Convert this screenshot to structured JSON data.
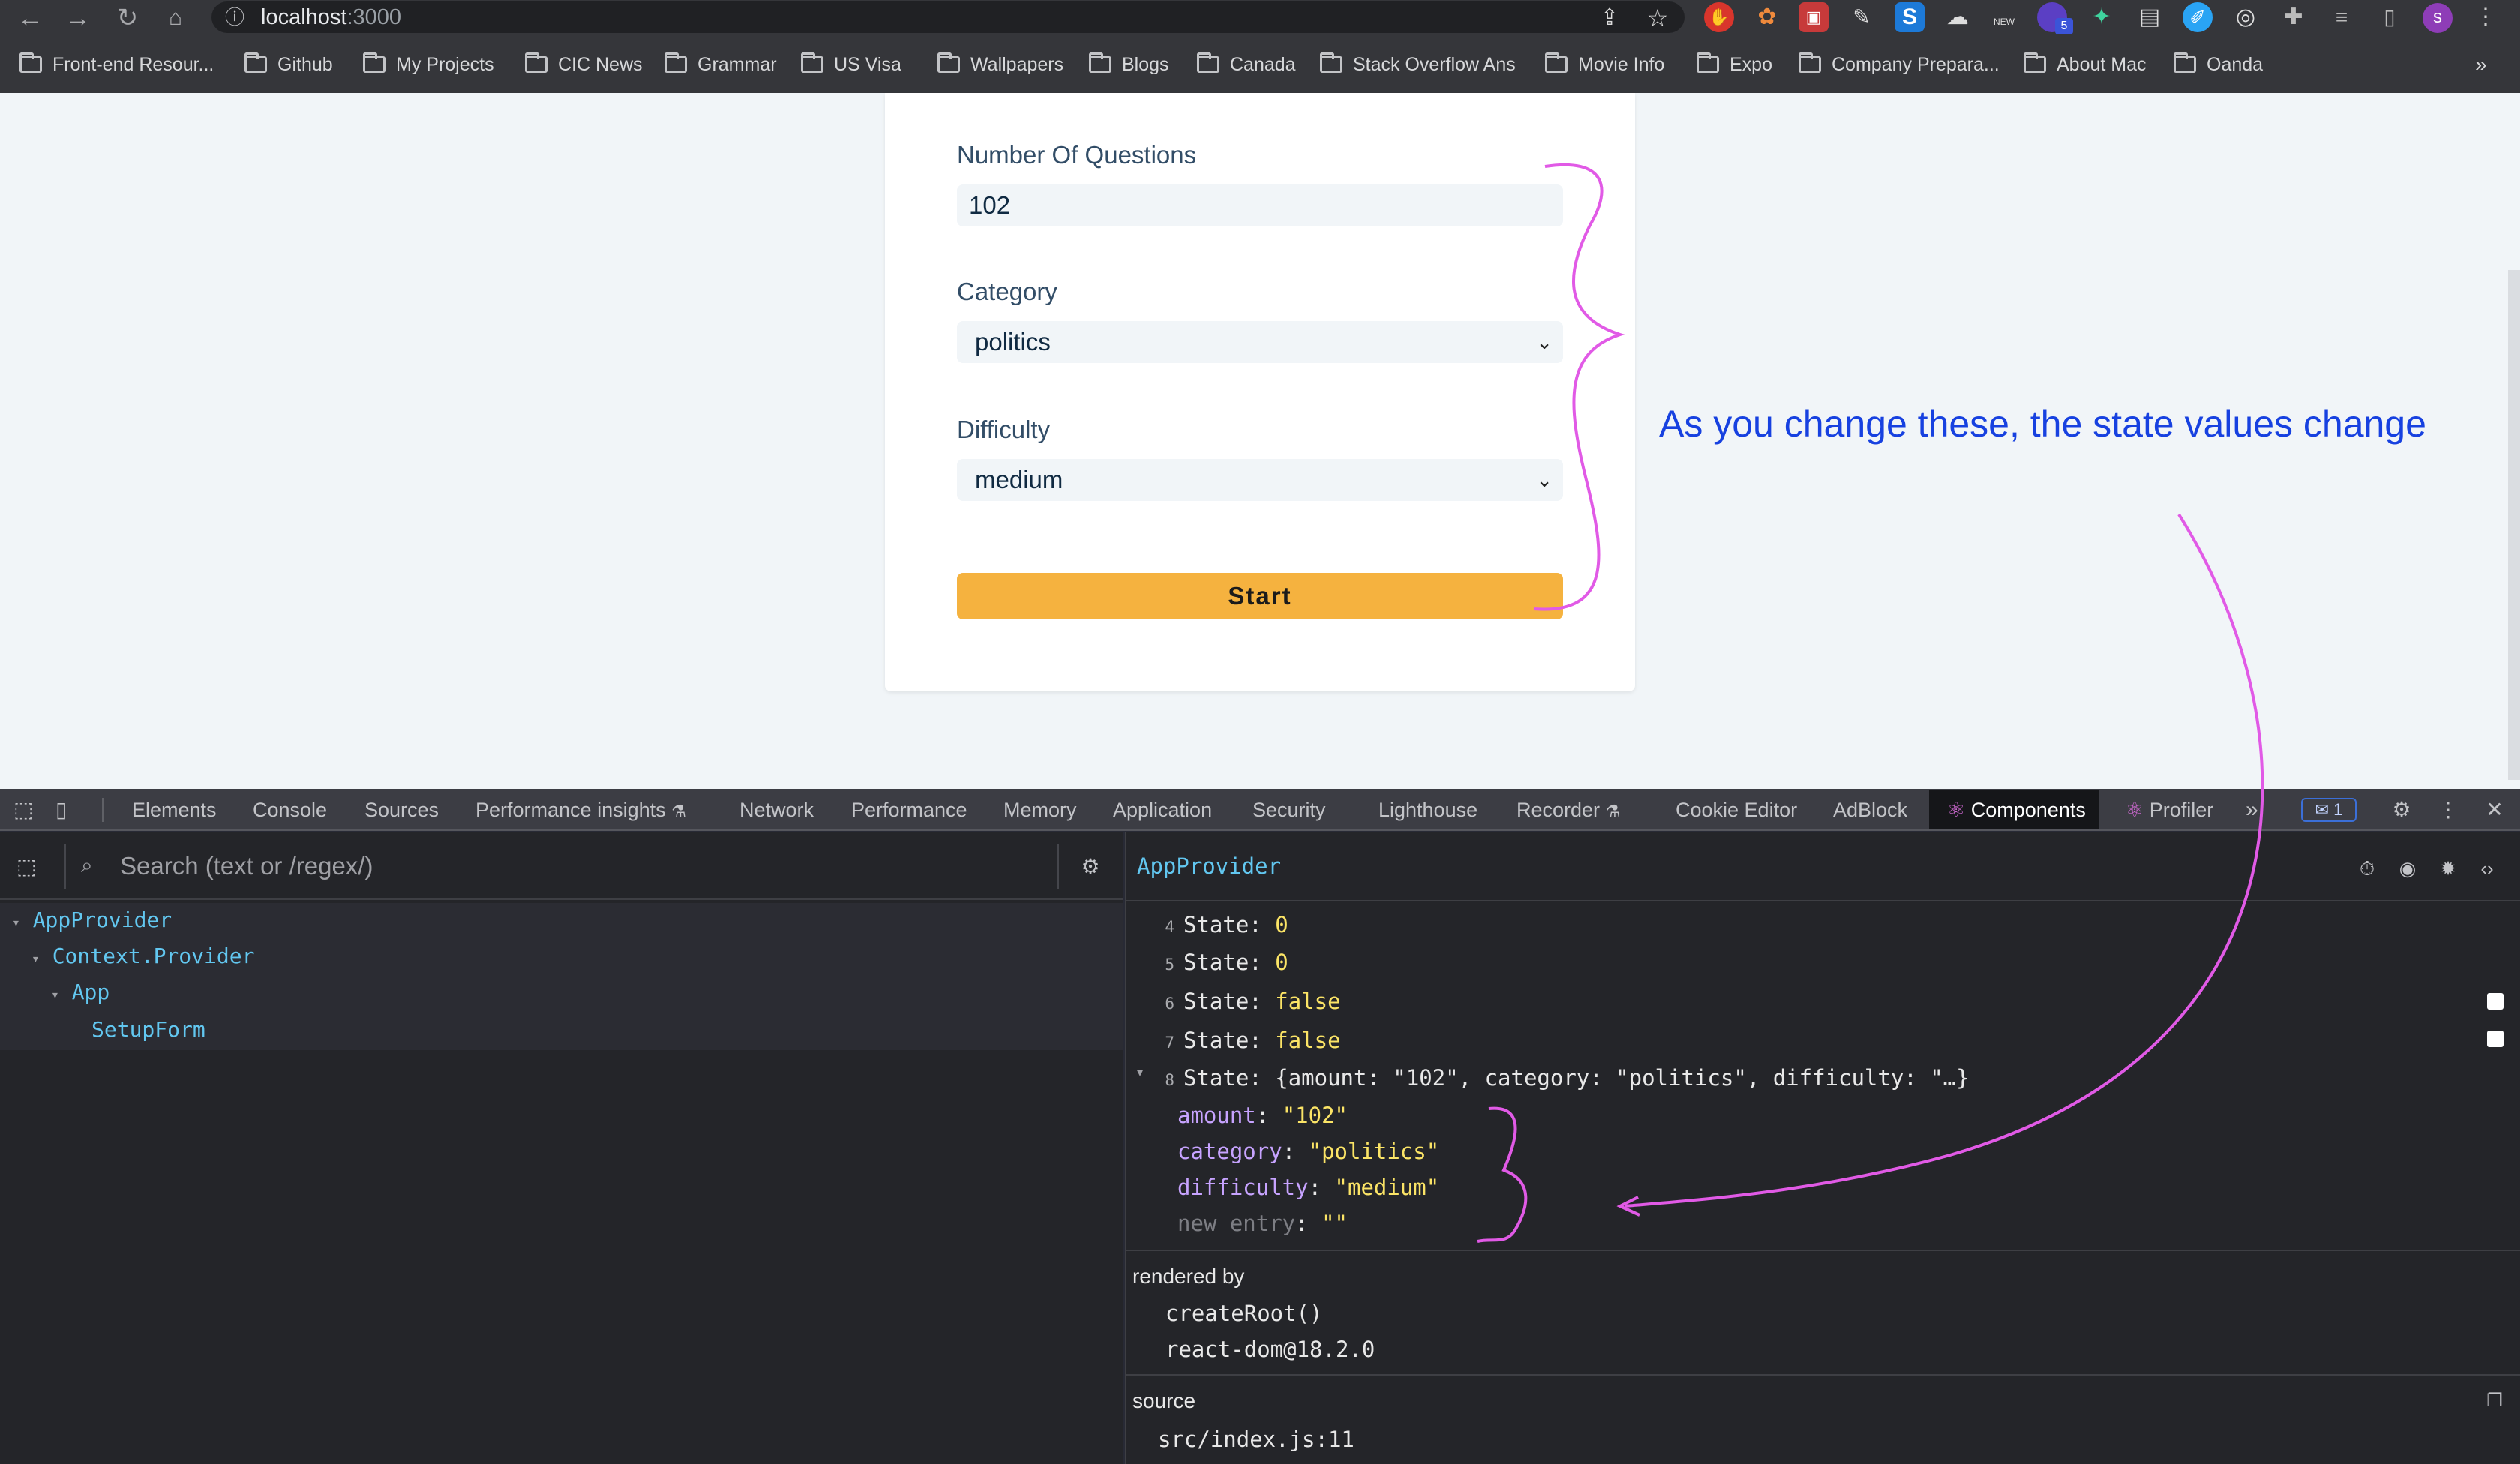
{
  "browser": {
    "url_host": "localhost",
    "url_port": ":3000",
    "bookmarks": [
      "Front-end Resour...",
      "Github",
      "My Projects",
      "CIC News",
      "Grammar",
      "US Visa",
      "Wallpapers",
      "Blogs",
      "Canada",
      "Stack Overflow Ans",
      "Movie Info",
      "Expo",
      "Company Prepara...",
      "About Mac",
      "Oanda"
    ],
    "more": "»",
    "ext_badge": "5",
    "ext_new": "NEW",
    "profile": "s"
  },
  "form": {
    "amount_label": "Number Of Questions",
    "amount_value": "102",
    "category_label": "Category",
    "category_value": "politics",
    "difficulty_label": "Difficulty",
    "difficulty_value": "medium",
    "start_label": "Start"
  },
  "annotation": {
    "text": "As you change these, the state values change",
    "color": "#1741e0",
    "brace_color": "#e15ae6"
  },
  "devtools": {
    "tabs": [
      "Elements",
      "Console",
      "Sources",
      "Performance insights",
      "Network",
      "Performance",
      "Memory",
      "Application",
      "Security",
      "Lighthouse",
      "Recorder",
      "Cookie Editor",
      "AdBlock",
      "Components",
      "Profiler"
    ],
    "more_tabs": "»",
    "issues_count": "1",
    "search_placeholder": "Search (text or /regex/)",
    "tree": [
      "AppProvider",
      "Context.Provider",
      "App",
      "SetupForm"
    ],
    "selected_component": "AppProvider",
    "state_rows": [
      {
        "index": "4",
        "label": "State:",
        "value": "0"
      },
      {
        "index": "5",
        "label": "State:",
        "value": "0"
      },
      {
        "index": "6",
        "label": "State:",
        "value": "false"
      },
      {
        "index": "7",
        "label": "State:",
        "value": "false"
      },
      {
        "index": "8",
        "label": "State:",
        "value": "{amount: \"102\", category: \"politics\", difficulty: \"…}"
      }
    ],
    "state_object": [
      {
        "key": "amount",
        "value": "\"102\""
      },
      {
        "key": "category",
        "value": "\"politics\""
      },
      {
        "key": "difficulty",
        "value": "\"medium\""
      },
      {
        "key": "new entry",
        "value": "\"\""
      }
    ],
    "rendered_by_title": "rendered by",
    "rendered_by": [
      "createRoot()",
      "react-dom@18.2.0"
    ],
    "source_title": "source",
    "source": "src/index.js:11",
    "accent_color": "#62c7f0",
    "value_color": "#fbe466"
  }
}
